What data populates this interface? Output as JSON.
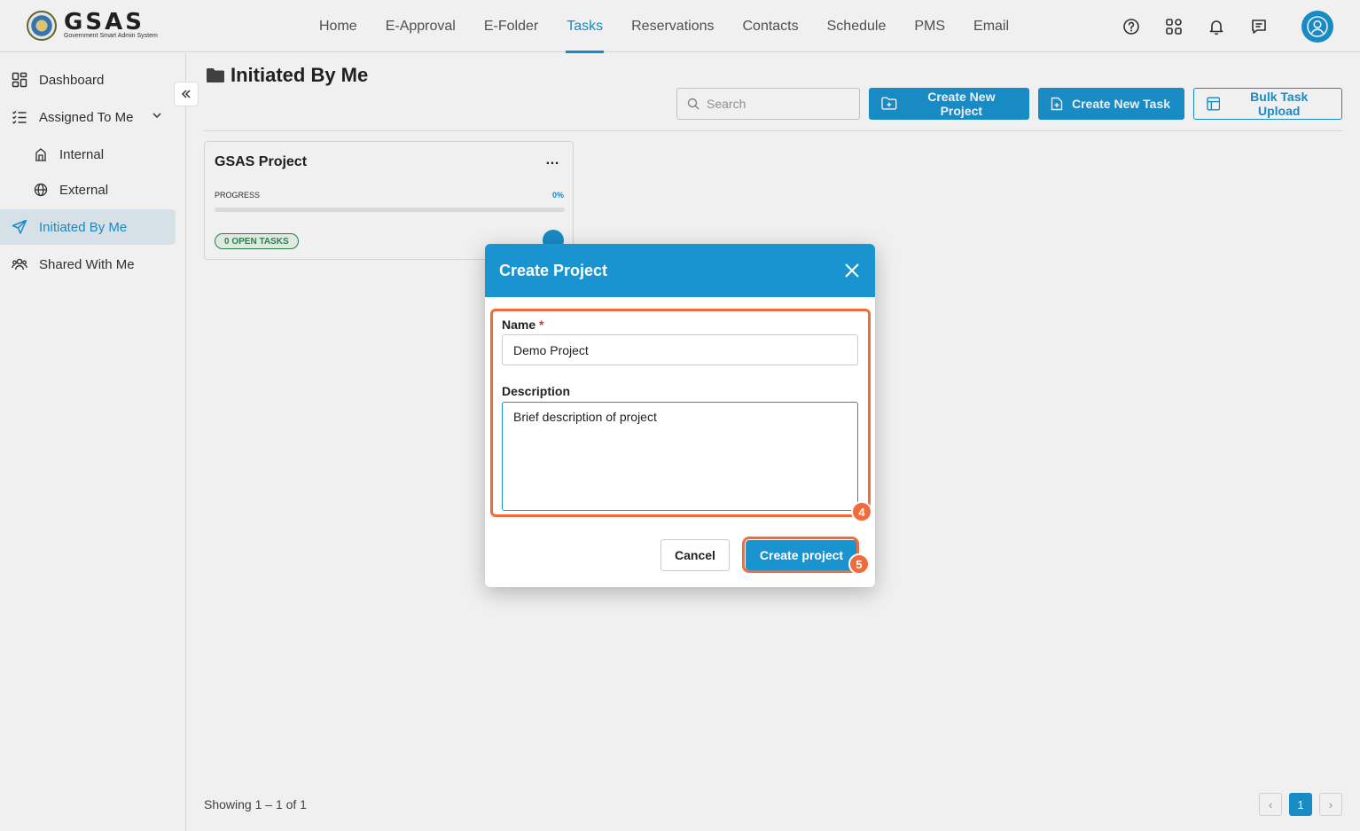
{
  "brand": {
    "title": "GSAS",
    "subtitle": "Government Smart Admin System"
  },
  "nav": {
    "items": [
      {
        "label": "Home"
      },
      {
        "label": "E-Approval"
      },
      {
        "label": "E-Folder"
      },
      {
        "label": "Tasks"
      },
      {
        "label": "Reservations"
      },
      {
        "label": "Contacts"
      },
      {
        "label": "Schedule"
      },
      {
        "label": "PMS"
      },
      {
        "label": "Email"
      }
    ],
    "active": "Tasks",
    "icons": [
      "help-icon",
      "apps-grid-icon",
      "bell-icon",
      "chat-icon",
      "user-avatar-icon"
    ]
  },
  "sidebar": {
    "items": [
      {
        "label": "Dashboard",
        "icon": "dashboard-icon"
      },
      {
        "label": "Assigned To Me",
        "icon": "list-check-icon"
      },
      {
        "label": "Internal",
        "icon": "building-icon"
      },
      {
        "label": "External",
        "icon": "globe-icon"
      },
      {
        "label": "Initiated By Me",
        "icon": "send-icon"
      },
      {
        "label": "Shared With Me",
        "icon": "users-icon"
      }
    ],
    "active": "Initiated By Me"
  },
  "page": {
    "title": "Initiated By Me",
    "search_placeholder": "Search",
    "buttons": {
      "create_project": "Create New Project",
      "create_task": "Create New Task",
      "bulk_upload": "Bulk Task Upload"
    }
  },
  "project_card": {
    "title": "GSAS Project",
    "menu": "…",
    "progress_label": "PROGRESS",
    "progress_value": "0%",
    "progress_fraction": 0,
    "open_tasks": "0 OPEN TASKS"
  },
  "footer": {
    "showing": "Showing 1 – 1 of 1",
    "current_page": "1",
    "prev": "‹",
    "next": "›"
  },
  "modal": {
    "title": "Create Project",
    "name_label": "Name",
    "required_mark": "*",
    "name_value": "Demo Project",
    "description_label": "Description",
    "description_value": "Brief description of project",
    "cancel_label": "Cancel",
    "submit_label": "Create project",
    "step_badges": [
      "4",
      "5"
    ]
  },
  "colors": {
    "accent": "#1a93d1",
    "highlight": "#f26b3a",
    "success": "#2f8a4f"
  }
}
